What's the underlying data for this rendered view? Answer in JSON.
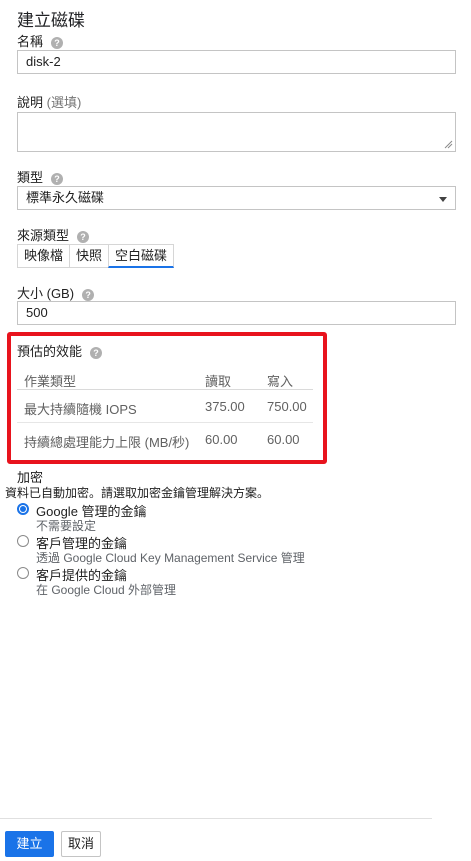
{
  "page": {
    "title": "建立磁碟"
  },
  "name_field": {
    "label": "名稱",
    "value": "disk-2"
  },
  "description_field": {
    "label": "說明",
    "optional": "(選填)",
    "value": ""
  },
  "type_field": {
    "label": "類型",
    "selected": "標準永久磁碟"
  },
  "source_type": {
    "label": "來源類型",
    "options": [
      "映像檔",
      "快照",
      "空白磁碟"
    ],
    "selected": "空白磁碟"
  },
  "size_field": {
    "label": "大小 (GB)",
    "value": "500"
  },
  "performance": {
    "title": "預估的效能",
    "headers": [
      "作業類型",
      "讀取",
      "寫入"
    ],
    "rows": [
      {
        "type": "最大持續隨機 IOPS",
        "read": "375.00",
        "write": "750.00"
      },
      {
        "type": "持續總處理能力上限 (MB/秒)",
        "read": "60.00",
        "write": "60.00"
      }
    ]
  },
  "encryption": {
    "label": "加密",
    "description": "資料已自動加密。請選取加密金鑰管理解決方案。",
    "options": [
      {
        "title": "Google 管理的金鑰",
        "desc": "不需要設定",
        "selected": true
      },
      {
        "title": "客戶管理的金鑰",
        "desc": "透過 Google Cloud Key Management Service 管理",
        "selected": false
      },
      {
        "title": "客戶提供的金鑰",
        "desc": "在 Google Cloud 外部管理",
        "selected": false
      }
    ]
  },
  "actions": {
    "create": "建立",
    "cancel": "取消"
  },
  "colors": {
    "accent": "#1a73e8",
    "highlight_box": "#e8131d"
  },
  "icons": {
    "help": "help-icon",
    "dropdown": "chevron-down-icon"
  }
}
